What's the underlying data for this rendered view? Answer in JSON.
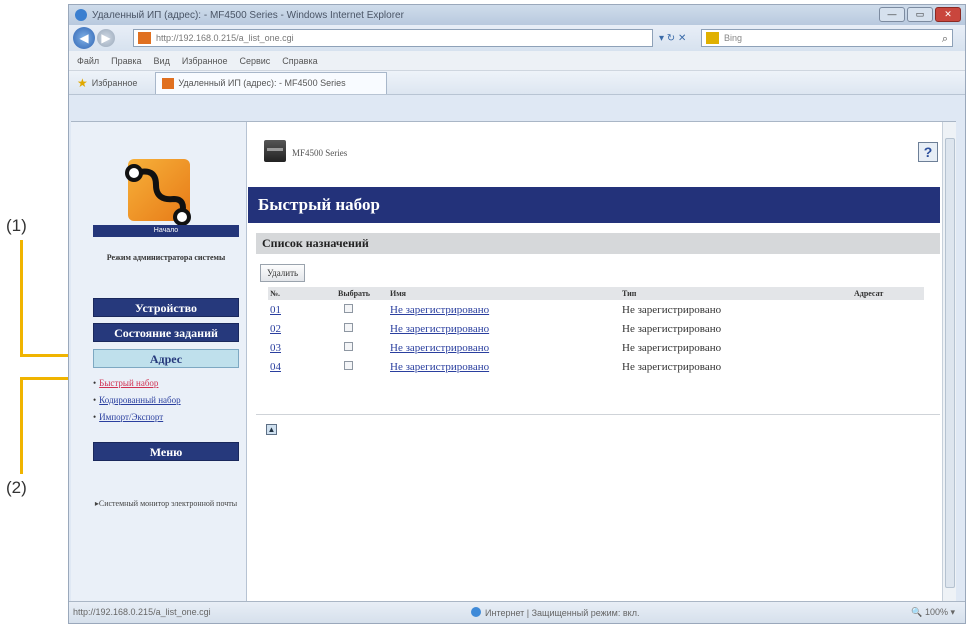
{
  "callouts": {
    "one": "(1)",
    "two": "(2)"
  },
  "browser": {
    "title": "Удаленный ИП (адрес): - MF4500 Series - Windows Internet Explorer",
    "address": "http://192.168.0.215/a_list_one.cgi",
    "search_placeholder": "Bing",
    "menu": [
      "Файл",
      "Правка",
      "Вид",
      "Избранное",
      "Сервис",
      "Справка"
    ],
    "favorites_label": "Избранное",
    "tab_title": "Удаленный ИП (адрес): - MF4500 Series",
    "window_controls": {
      "minimize": "—",
      "maximize": "▭",
      "close": "✕"
    }
  },
  "sidebar": {
    "home": "Начало",
    "mode": "Режим администратора системы",
    "buttons": {
      "device": "Устройство",
      "job_status": "Состояние заданий",
      "address": "Адрес",
      "menu": "Меню"
    },
    "links": {
      "speed_dial": "Быстрый набор",
      "coded_dial": "Кодированный набор",
      "import_export": "Импорт/Экспорт"
    },
    "note": "Системный монитор электронной почты"
  },
  "content": {
    "model": "MF4500 Series",
    "help": "?",
    "page_title": "Быстрый набор",
    "section_title": "Список назначений",
    "delete_button": "Удалить",
    "table": {
      "headers": {
        "no": "№.",
        "select": "Выбрать",
        "name": "Имя",
        "type": "Тип",
        "address": "Адресат"
      },
      "rows": [
        {
          "no": "01",
          "name": "Не зарегистрировано",
          "type": "Не зарегистрировано"
        },
        {
          "no": "02",
          "name": "Не зарегистрировано",
          "type": "Не зарегистрировано"
        },
        {
          "no": "03",
          "name": "Не зарегистрировано",
          "type": "Не зарегистрировано"
        },
        {
          "no": "04",
          "name": "Не зарегистрировано",
          "type": "Не зарегистрировано"
        }
      ]
    }
  },
  "statusbar": {
    "url": "http://192.168.0.215/a_list_one.cgi",
    "zone": "Интернет | Защищенный режим: вкл.",
    "zoom": "100%"
  },
  "colors": {
    "nav_blue": "#26397c",
    "active_tab": "#bfe0ec",
    "callout_line": "#f0b400"
  }
}
